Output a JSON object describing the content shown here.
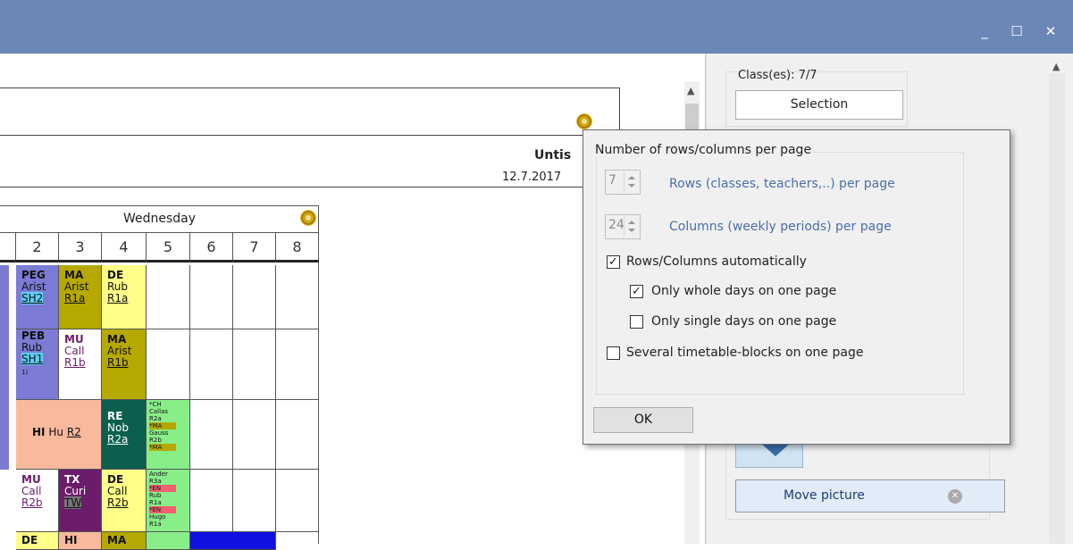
{
  "window": {
    "buttons": {
      "minimize": "_",
      "maximize": "☐",
      "close": "✕"
    }
  },
  "header": {
    "title": "Untis",
    "date": "12.7.2017"
  },
  "timetable": {
    "day": "Wednesday",
    "periods": [
      "2",
      "3",
      "4",
      "5",
      "6",
      "7",
      "8"
    ],
    "cells": {
      "r1c2": {
        "subject": "PEG",
        "teacher": "Arist",
        "room": "SH2"
      },
      "r1c3": {
        "subject": "MA",
        "teacher": "Arist",
        "room": "R1a"
      },
      "r1c4": {
        "subject": "DE",
        "teacher": "Rub",
        "room": "R1a"
      },
      "r2c2": {
        "subject": "PEB",
        "teacher": "Rub",
        "room": "SH1",
        "note": "1)"
      },
      "r2c3": {
        "subject": "MU",
        "teacher": "Call",
        "room": "R1b"
      },
      "r2c4": {
        "subject": "MA",
        "teacher": "Arist",
        "room": "R1b"
      },
      "r3c23": {
        "subject": "HI",
        "teacher": "Hu",
        "room": "R2"
      },
      "r3c4": {
        "subject": "RE",
        "teacher": "Nob",
        "room": "R2a"
      },
      "r3c5": {
        "lines": [
          "*CH",
          "Callas",
          "R2a",
          "*MA",
          "Gauss",
          "R2b",
          "*MA"
        ]
      },
      "r4c2": {
        "subject": "MU",
        "teacher": "Call",
        "room": "R2b"
      },
      "r4c3": {
        "subject": "TX",
        "teacher": "Curi",
        "room": "TW"
      },
      "r4c4": {
        "subject": "DE",
        "teacher": "Call",
        "room": "R2b"
      },
      "r4c5": {
        "lines": [
          "Ander",
          "R3a",
          "*EN",
          "Rub",
          "R1a",
          "*EN",
          "Hugo",
          "R1a"
        ]
      },
      "r5c2": {
        "subject": "DE"
      },
      "r5c3": {
        "subject": "HI"
      },
      "r5c4": {
        "subject": "MA"
      }
    }
  },
  "right_panel": {
    "classes_label": "Class(es): 7/7",
    "selection_button": "Selection",
    "move_picture_button": "Move picture"
  },
  "dialog": {
    "group_title": "Number of rows/columns per page",
    "rows_value": "7",
    "rows_label": "Rows (classes, teachers,..) per page",
    "cols_value": "24",
    "cols_label": "Columns (weekly periods) per page",
    "auto_label": "Rows/Columns automatically",
    "auto_checked": "✓",
    "whole_days_label": "Only whole days on one page",
    "whole_days_checked": "✓",
    "single_days_label": "Only single days on one page",
    "several_blocks_label": "Several timetable-blocks on one page",
    "ok_button": "OK"
  },
  "colors": {
    "titlebar": "#6b87b5",
    "pe": "#7b7bd6",
    "ma": "#b5a800",
    "de": "#ffff88",
    "hi": "#f9b99c",
    "re": "#0b5f4f",
    "tx": "#6b1c6b",
    "green": "#88ee88",
    "blue": "#1010e0"
  }
}
